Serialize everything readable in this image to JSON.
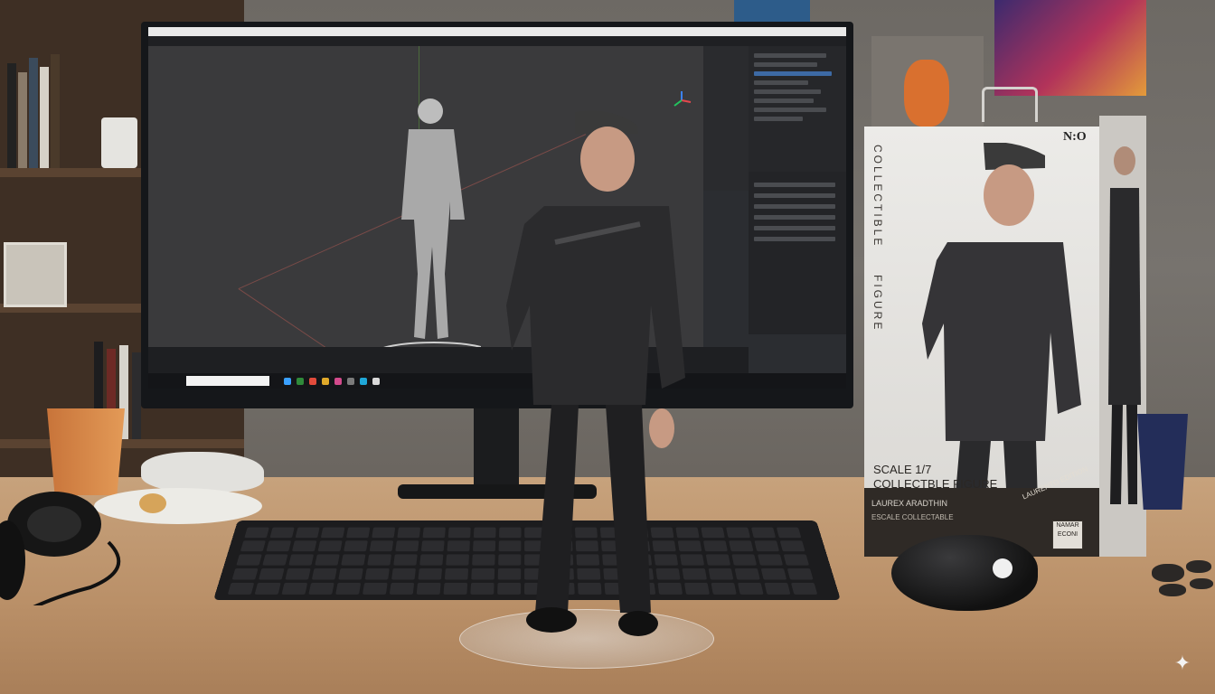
{
  "scene": {
    "description_colors": {
      "desk": "#b98f67",
      "wall": "#6d6964",
      "monitor": "#15171a",
      "figure_jacket": "#2a2a2c",
      "box": "#e6e4e0"
    }
  },
  "monitor_ui": {
    "taskbar_icons": [
      "#3aa0ff",
      "#2f8a3a",
      "#e14b3b",
      "#e0a92a",
      "#d34a8c",
      "#7b7b7b",
      "#1fa7d8",
      "#d9d9d9"
    ]
  },
  "box": {
    "brand": "N:O",
    "vertical_text_1": "COLLECTIBLE",
    "vertical_text_2": "FIGURE",
    "scale_line_1": "SCALE 1/7",
    "scale_line_2": "COLLECTBLE FIGURE",
    "name_line": "LAUREX ARADTHIN",
    "sub_line": "ESCALE COLLECTABLE",
    "side_label": "LAURENTO EDITION",
    "logo_line_1": "NAMAR",
    "logo_line_2": "ECONI"
  },
  "icons": {
    "sparkle": "sparkle-icon"
  }
}
